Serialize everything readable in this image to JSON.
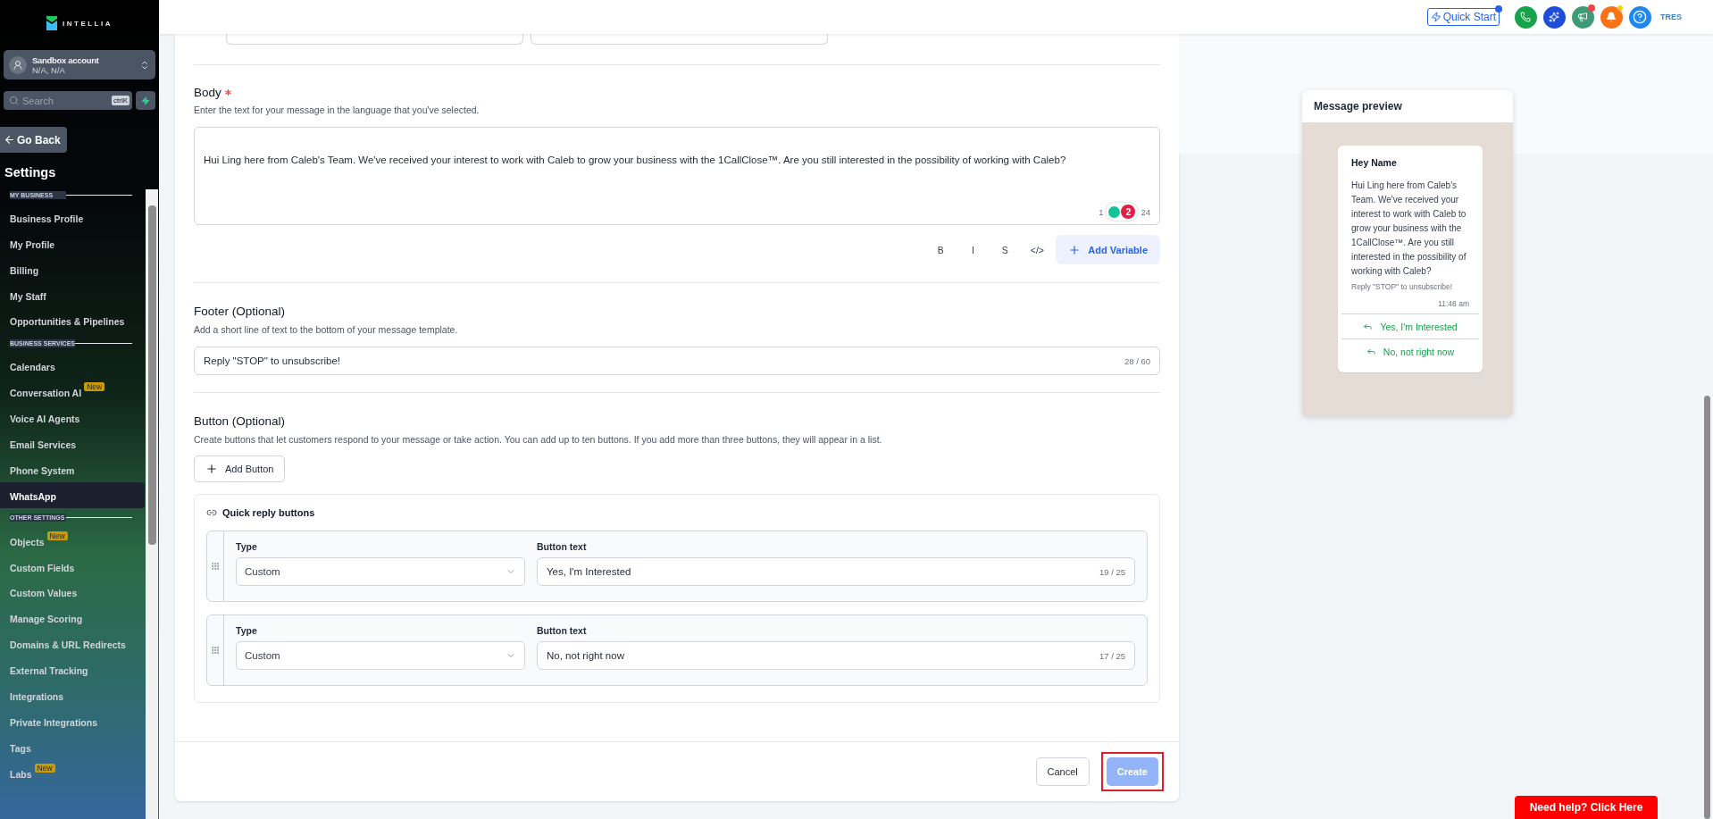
{
  "sidebar": {
    "brand": "INTELLIA",
    "account": {
      "name": "Sandbox account",
      "location": "N/A, N/A"
    },
    "search": {
      "placeholder": "Search",
      "shortcut": "ctrlK"
    },
    "back_button": "Go Back",
    "title": "Settings",
    "items": [
      {
        "kind": "section",
        "label": "MY BUSINESS"
      },
      {
        "kind": "link",
        "label": "Business Profile",
        "selected": false
      },
      {
        "kind": "link",
        "label": "My Profile",
        "selected": false
      },
      {
        "kind": "link",
        "label": "Billing",
        "selected": false
      },
      {
        "kind": "link",
        "label": "My Staff",
        "selected": false
      },
      {
        "kind": "link",
        "label": "Opportunities & Pipelines",
        "selected": false
      },
      {
        "kind": "section",
        "label": "BUSINESS SERVICES"
      },
      {
        "kind": "link",
        "label": "Calendars",
        "selected": false
      },
      {
        "kind": "link",
        "label": "Conversation AI",
        "selected": false,
        "badge": "New"
      },
      {
        "kind": "link",
        "label": "Voice AI Agents",
        "selected": false
      },
      {
        "kind": "link",
        "label": "Email Services",
        "selected": false
      },
      {
        "kind": "link",
        "label": "Phone System",
        "selected": false
      },
      {
        "kind": "link",
        "label": "WhatsApp",
        "selected": true
      },
      {
        "kind": "section",
        "label": "OTHER SETTINGS"
      },
      {
        "kind": "link",
        "label": "Objects",
        "selected": false,
        "badge": "New"
      },
      {
        "kind": "link",
        "label": "Custom Fields",
        "selected": false
      },
      {
        "kind": "link",
        "label": "Custom Values",
        "selected": false
      },
      {
        "kind": "link",
        "label": "Manage Scoring",
        "selected": false
      },
      {
        "kind": "link",
        "label": "Domains & URL Redirects",
        "selected": false
      },
      {
        "kind": "link",
        "label": "External Tracking",
        "selected": false
      },
      {
        "kind": "link",
        "label": "Integrations",
        "selected": false
      },
      {
        "kind": "link",
        "label": "Private Integrations",
        "selected": false
      },
      {
        "kind": "link",
        "label": "Tags",
        "selected": false
      },
      {
        "kind": "link",
        "label": "Labs",
        "selected": false,
        "badge": "New"
      }
    ]
  },
  "header": {
    "quick_start": "Quick Start",
    "user": "TRES"
  },
  "form": {
    "body": {
      "label": "Body",
      "required": true,
      "hint": "Enter the text for your message in the language that you've selected.",
      "value": "Hui Ling here from Caleb's Team. We've received your interest to work with Caleb to grow your business with the 1CallClose™. Are you still interested in the possibility of working with Caleb?",
      "counter": [
        "1",
        "24"
      ],
      "grammar_count": "2",
      "format_buttons": [
        "B",
        "I",
        "S",
        "</>"
      ],
      "add_variable": "Add Variable"
    },
    "footer": {
      "label": "Footer (Optional)",
      "hint": "Add a short line of text to the bottom of your message template.",
      "value": "Reply \"STOP\" to unsubscribe!",
      "counter": "28 / 60"
    },
    "buttons": {
      "label": "Button (Optional)",
      "hint": "Create buttons that let customers respond to your message or take action. You can add up to ten buttons. If you add more than three buttons, they will appear in a list.",
      "add_button": "Add Button",
      "quick_replies": {
        "title": "Quick reply buttons",
        "rows": [
          {
            "type_label": "Type",
            "type_value": "Custom",
            "text_label": "Button text",
            "text_value": "Yes, I'm Interested",
            "counter": "19 / 25"
          },
          {
            "type_label": "Type",
            "type_value": "Custom",
            "text_label": "Button text",
            "text_value": "No, not right now",
            "counter": "17 / 25"
          }
        ]
      }
    },
    "actions": {
      "cancel": "Cancel",
      "create": {
        "label": "Create",
        "disabled": true,
        "highlighted": true
      }
    }
  },
  "preview": {
    "title": "Message preview",
    "header": "Hey Name",
    "body": "Hui Ling here from Caleb's Team. We've received your interest to work with Caleb to grow your business with the 1CallClose™. Are you still interested in the possibility of working with Caleb?",
    "footer": "Reply \"STOP\" to unsubscribe!",
    "time": "11:48 am",
    "buttons": [
      "Yes, I'm Interested",
      "No, not right now"
    ]
  },
  "help_button": "Need help? Click Here"
}
